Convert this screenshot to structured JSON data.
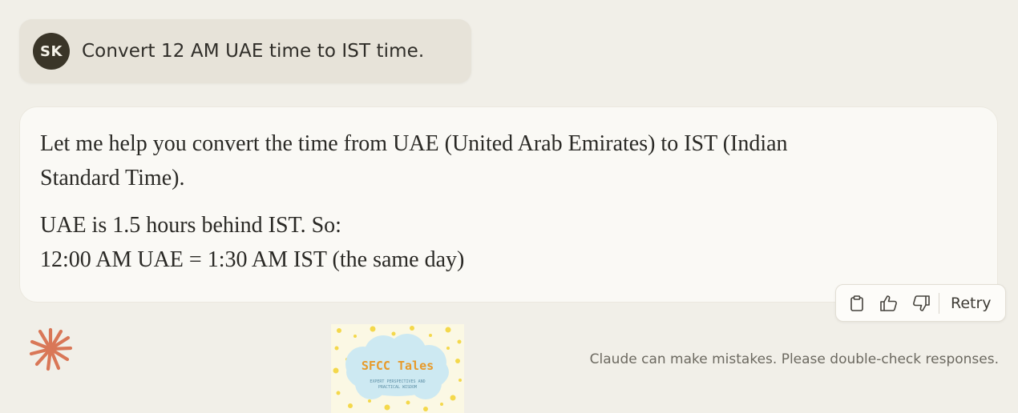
{
  "user_message": {
    "initials": "SK",
    "text": "Convert 12 AM UAE time to IST time."
  },
  "assistant_message": {
    "paragraph1": "Let me help you convert the time from UAE (United Arab Emirates) to IST (Indian Standard Time).",
    "paragraph2_line1": "UAE is 1.5 hours behind IST. So:",
    "paragraph2_line2": "12:00 AM UAE = 1:30 AM IST (the same day)"
  },
  "actions": {
    "copy_icon": "clipboard-icon",
    "like_icon": "thumbs-up-icon",
    "dislike_icon": "thumbs-down-icon",
    "retry_label": "Retry"
  },
  "sticker": {
    "title": "SFCC Tales",
    "subtitle_line1": "EXPERT PERSPECTIVES AND",
    "subtitle_line2": "PRACTICAL WISDOM"
  },
  "footer": {
    "disclaimer": "Claude can make mistakes. Please double-check responses."
  },
  "colors": {
    "background": "#f1efe8",
    "user_bubble": "#e7e3d9",
    "assistant_bubble": "#faf9f5",
    "avatar": "#3a3528",
    "claude_accent": "#d97757",
    "sticker_cloud": "#cde9f2",
    "sticker_title": "#e79a2a"
  }
}
